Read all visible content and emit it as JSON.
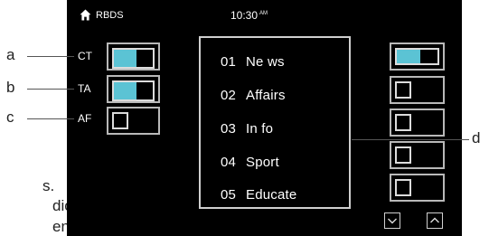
{
  "status_bar": {
    "app_title": "RBDS",
    "time": "10:30",
    "meridiem": "AM"
  },
  "settings": [
    {
      "label": "CT",
      "state": "on"
    },
    {
      "label": "TA",
      "state": "on"
    },
    {
      "label": "AF",
      "state": "off"
    }
  ],
  "presets": [
    {
      "number": "01",
      "name": "Ne ws"
    },
    {
      "number": "02",
      "name": "Affairs"
    },
    {
      "number": "03",
      "name": "In fo"
    },
    {
      "number": "04",
      "name": "Sport"
    },
    {
      "number": "05",
      "name": "Educate"
    }
  ],
  "callouts": [
    "a",
    "b",
    "c",
    "d"
  ],
  "page_fragments": [
    "s.",
    "dio",
    "ent"
  ],
  "colors": {
    "accent": "#5bc3d4",
    "screen_bg": "#000000",
    "frame": "#b9b9b9"
  }
}
